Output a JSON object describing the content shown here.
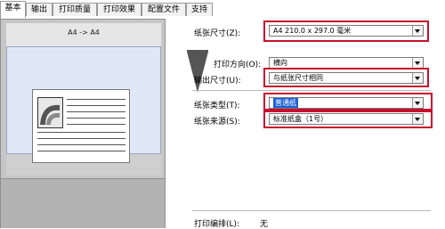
{
  "tabs": [
    {
      "label": "基本"
    },
    {
      "label": "输出"
    },
    {
      "label": "打印质量"
    },
    {
      "label": "打印效果"
    },
    {
      "label": "配置文件"
    },
    {
      "label": "支持"
    }
  ],
  "preview": {
    "title": "A4 -> A4"
  },
  "settings": {
    "paper_size": {
      "label": "纸张尺寸(Z):",
      "value": "A4  210.0 x 297.0 毫米"
    },
    "orientation": {
      "label": "打印方向(O):",
      "value": "横向"
    },
    "output_size": {
      "label": "输出尺寸(U):",
      "value": "与纸张尺寸相同"
    },
    "media_type": {
      "label": "纸张类型(T):",
      "value": "普通纸"
    },
    "paper_source": {
      "label": "纸张来源(S):",
      "value": "标准纸盒（1号）"
    },
    "print_layout": {
      "label": "打印编排(L):",
      "value": "无"
    }
  },
  "colors": {
    "highlight": "#c8102e",
    "selection": "#1a5fd6"
  }
}
